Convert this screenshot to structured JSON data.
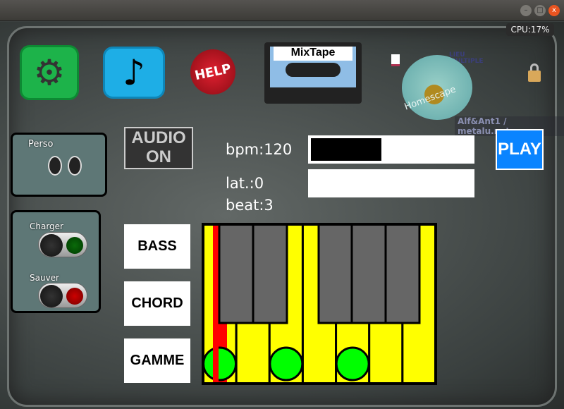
{
  "window": {
    "min": "–",
    "max": "□",
    "close": "x"
  },
  "cpu": "CPU:17%",
  "toolbar": {
    "mixtape": "MixTape",
    "help": "HELP",
    "homescape": "Homescape",
    "lieu": "LIEU MULTIPLE",
    "credit": "Alf&Ant1 / metalu.net"
  },
  "perso": {
    "label": "Perso",
    "logo_text": "Alf&Ant1"
  },
  "files": {
    "load": "Charger",
    "save": "Sauver"
  },
  "audio": {
    "line1": "AUDIO",
    "line2": "ON"
  },
  "bpm": {
    "label": "bpm:120",
    "value": 120,
    "fill": 0.44
  },
  "lat": {
    "label": "lat.:0",
    "fill": 0
  },
  "beat": "beat:3",
  "play": "PLAY",
  "modes": [
    "BASS",
    "CHORD",
    "GAMME"
  ],
  "colors": {
    "play": "#0a84ff",
    "key_white": "#ffff00",
    "key_black": "#666666",
    "cursor": "#ff0000",
    "note": "#00ff00"
  },
  "keyboard": {
    "white_keys": 7,
    "black_keys": 5,
    "notes_on_white_keys": [
      0,
      2,
      4
    ],
    "cursor_key": 0
  }
}
